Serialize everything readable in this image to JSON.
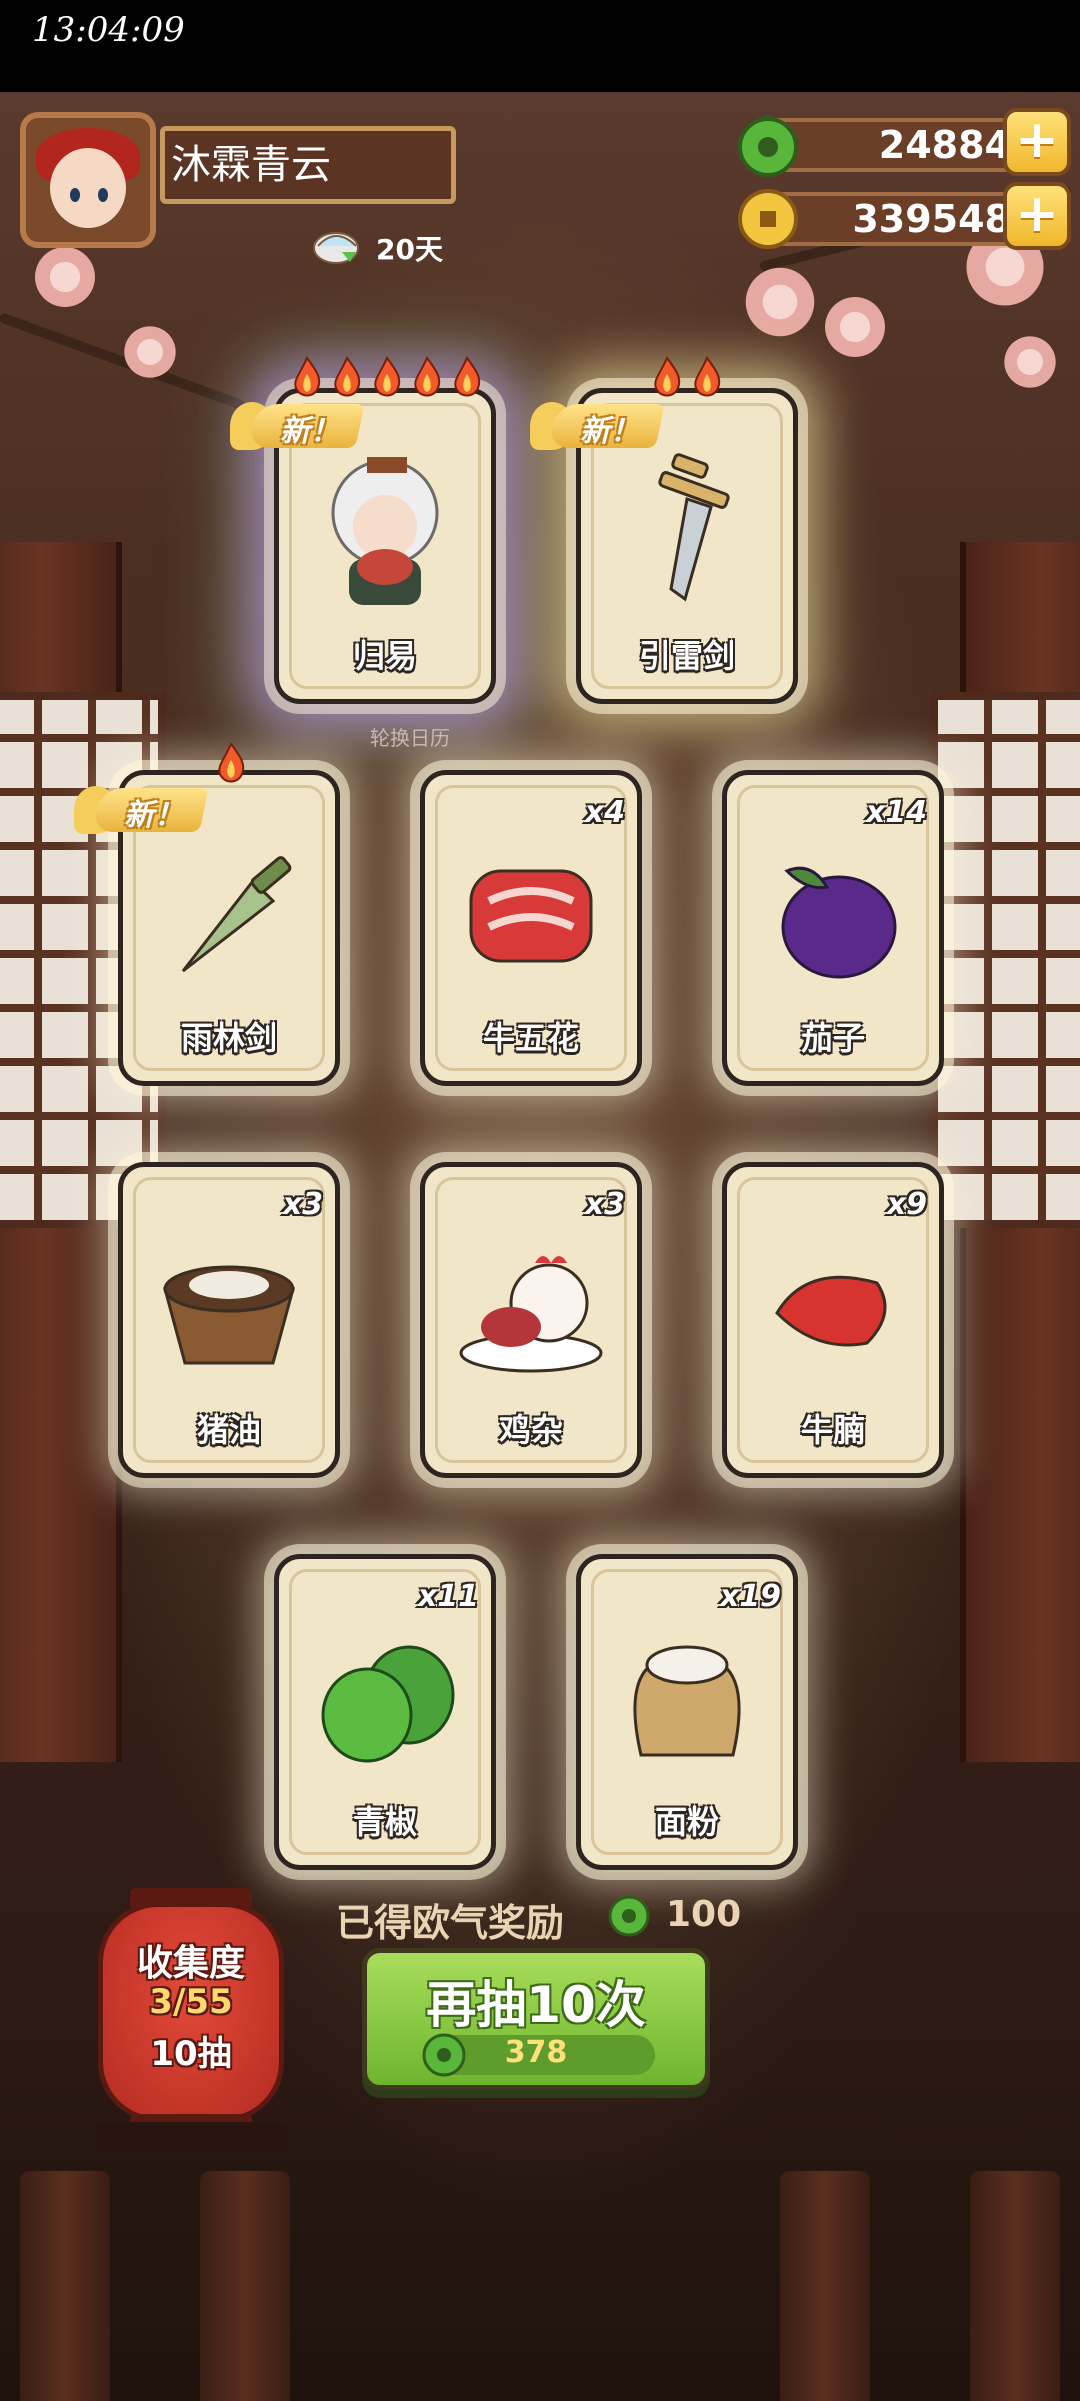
{
  "status_bar": {
    "time": "13:04:09"
  },
  "player": {
    "name": "沐霖青云",
    "days": "20天"
  },
  "currencies": [
    {
      "name": "jade",
      "value": "24884",
      "plus": "+"
    },
    {
      "name": "coin",
      "value": "339548",
      "plus": "+"
    }
  ],
  "rotation_label": "轮换日历",
  "new_badge": "新！",
  "cards": [
    {
      "name": "归易",
      "count": "",
      "is_new": true,
      "flames": 5
    },
    {
      "name": "引雷剑",
      "count": "",
      "is_new": true,
      "flames": 2
    },
    {
      "name": "雨林剑",
      "count": "",
      "is_new": true,
      "flames": 1
    },
    {
      "name": "牛五花",
      "count": "x4",
      "is_new": false,
      "flames": 0
    },
    {
      "name": "茄子",
      "count": "x14",
      "is_new": false,
      "flames": 0
    },
    {
      "name": "猪油",
      "count": "x3",
      "is_new": false,
      "flames": 0
    },
    {
      "name": "鸡杂",
      "count": "x3",
      "is_new": false,
      "flames": 0
    },
    {
      "name": "牛腩",
      "count": "x9",
      "is_new": false,
      "flames": 0
    },
    {
      "name": "青椒",
      "count": "x11",
      "is_new": false,
      "flames": 0
    },
    {
      "name": "面粉",
      "count": "x19",
      "is_new": false,
      "flames": 0
    }
  ],
  "reward": {
    "label": "已得欧气奖励",
    "value": "100"
  },
  "draw_button": {
    "label": "再抽10次",
    "cost": "378"
  },
  "collection": {
    "title": "收集度",
    "progress": "3/55",
    "draws": "10抽"
  },
  "colors": {
    "accent_green": "#7cc23a",
    "gold": "#f0b72b",
    "card_bg": "#f2e6c8"
  }
}
